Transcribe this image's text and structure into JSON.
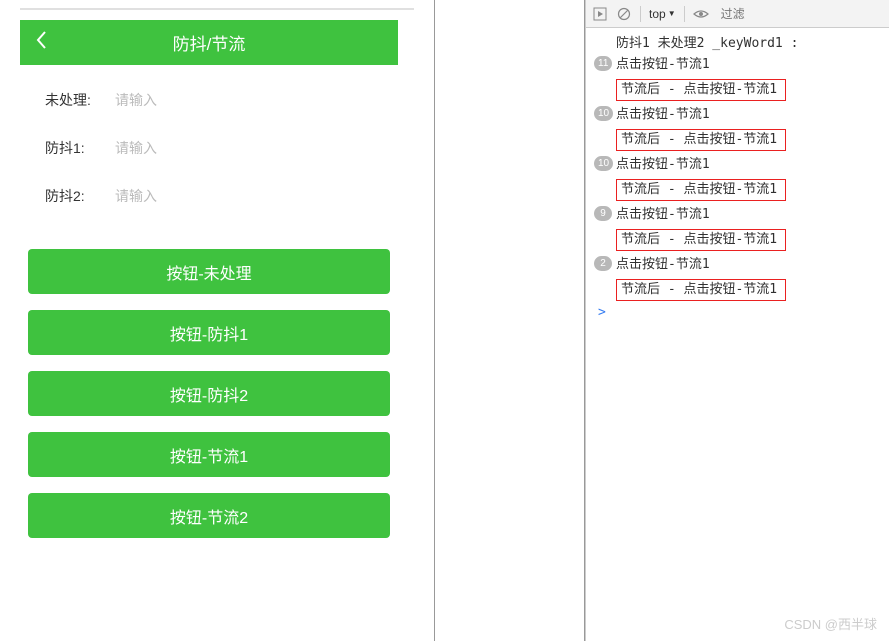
{
  "header": {
    "title": "防抖/节流"
  },
  "form": {
    "rows": [
      {
        "label": "未处理:",
        "placeholder": "请输入"
      },
      {
        "label": "防抖1:",
        "placeholder": "请输入"
      },
      {
        "label": "防抖2:",
        "placeholder": "请输入"
      }
    ]
  },
  "buttons": [
    {
      "label": "按钮-未处理"
    },
    {
      "label": "按钮-防抖1"
    },
    {
      "label": "按钮-防抖2"
    },
    {
      "label": "按钮-节流1"
    },
    {
      "label": "按钮-节流2"
    }
  ],
  "toolbar": {
    "context": "top",
    "dropdown_caret": "▼",
    "filter_placeholder": "过滤"
  },
  "console": {
    "header_text": "防抖1 未处理2 _keyWord1 :",
    "prompt": ">",
    "logs": [
      {
        "badge": "11",
        "text": "点击按钮-节流1",
        "boxed": false
      },
      {
        "badge": "",
        "text": "节流后 - 点击按钮-节流1",
        "boxed": true
      },
      {
        "badge": "10",
        "text": "点击按钮-节流1",
        "boxed": false
      },
      {
        "badge": "",
        "text": "节流后 - 点击按钮-节流1",
        "boxed": true
      },
      {
        "badge": "10",
        "text": "点击按钮-节流1",
        "boxed": false
      },
      {
        "badge": "",
        "text": "节流后 - 点击按钮-节流1",
        "boxed": true
      },
      {
        "badge": "9",
        "text": "点击按钮-节流1",
        "boxed": false
      },
      {
        "badge": "",
        "text": "节流后 - 点击按钮-节流1",
        "boxed": true
      },
      {
        "badge": "2",
        "text": "点击按钮-节流1",
        "boxed": false
      },
      {
        "badge": "",
        "text": "节流后 - 点击按钮-节流1",
        "boxed": true
      }
    ]
  },
  "watermark": "CSDN @西半球"
}
